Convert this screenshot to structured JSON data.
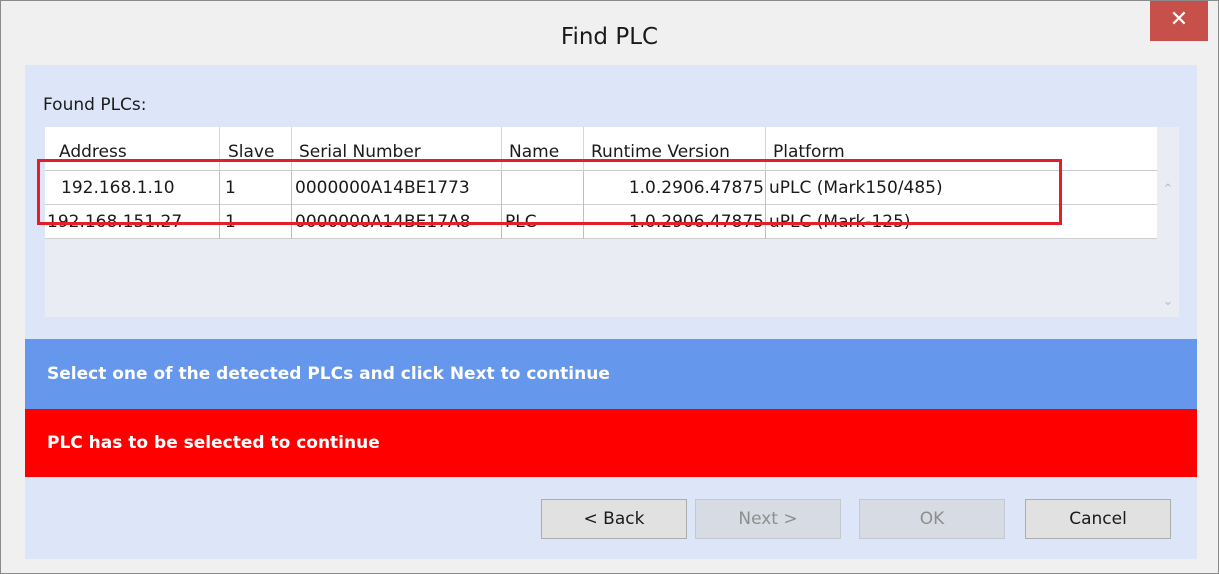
{
  "window": {
    "title": "Find PLC",
    "close_glyph": "✕"
  },
  "found_label": "Found PLCs:",
  "table": {
    "columns": [
      "Address",
      "Slave",
      "Serial Number",
      "Name",
      "Runtime Version",
      "Platform"
    ],
    "rows": [
      [
        "192.168.1.10",
        "1",
        "0000000A14BE1773",
        "",
        "1.0.2906.47875",
        "uPLC (Mark150/485)"
      ],
      [
        "192.168.151.27",
        "1",
        "0000000A14BE17A8",
        "PLC",
        "1.0.2906.47875",
        "uPLC (Mark-125)"
      ]
    ]
  },
  "scroll": {
    "up_glyph": "⌃",
    "down_glyph": "⌄"
  },
  "info_message": "Select one of the detected PLCs and click Next to continue",
  "error_message": "PLC has to be selected to continue",
  "buttons": {
    "back": "< Back",
    "next": "Next >",
    "ok": "OK",
    "cancel": "Cancel"
  },
  "colors": {
    "info_bar": "#6597ec",
    "error_bar": "#fe0000",
    "highlight": "#e41e2b",
    "close_button": "#c7504b"
  }
}
